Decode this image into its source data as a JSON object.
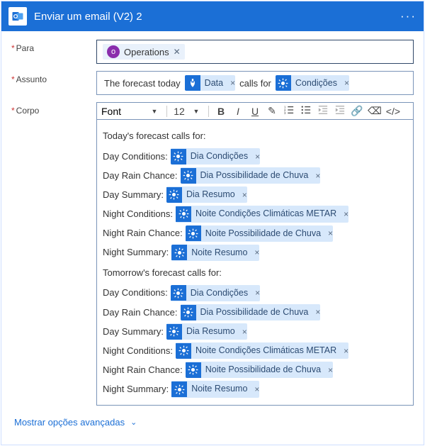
{
  "header": {
    "title": "Enviar um email (V2) 2"
  },
  "labels": {
    "to": "Para",
    "subject": "Assunto",
    "body": "Corpo"
  },
  "to": {
    "recipient": "Operations"
  },
  "subject": {
    "pre": "The forecast today",
    "tok1": "Data",
    "mid": " calls for",
    "tok2": "Condições"
  },
  "toolbar": {
    "font": "Font",
    "size": "12"
  },
  "editor": {
    "sec1": "Today's forecast calls for:",
    "sec2": "Tomorrow's forecast calls for:",
    "rows": {
      "dc": "Day Conditions:",
      "drc": "Day Rain Chance:",
      "ds": "Day Summary:",
      "nc": "Night Conditions:",
      "nrc": "Night Rain Chance:",
      "ns": "Night Summary:"
    },
    "toks": {
      "dc": "Dia Condições",
      "drc": "Dia Possibilidade de Chuva",
      "ds": "Dia Resumo",
      "nc": "Noite Condições Climáticas METAR",
      "nrc": "Noite Possibilidade de Chuva",
      "ns": "Noite Resumo"
    }
  },
  "advanced": "Mostrar opções avançadas"
}
